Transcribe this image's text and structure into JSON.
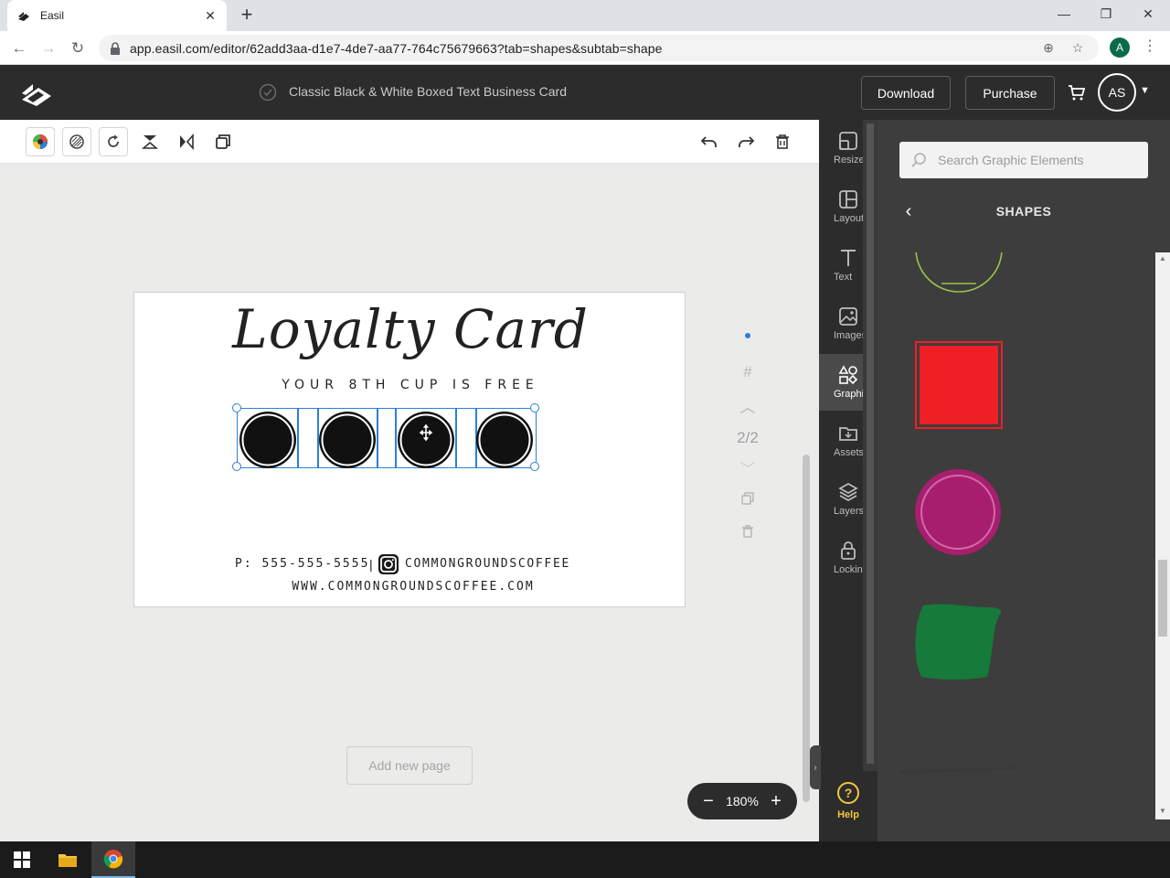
{
  "browser": {
    "tab_title": "Easil",
    "url": "app.easil.com/editor/62add3aa-d1e7-4de7-aa77-764c75679663?tab=shapes&subtab=shape",
    "profile_initial": "A"
  },
  "header": {
    "doc_title": "Classic Black & White Boxed Text Business Card",
    "download_label": "Download",
    "purchase_label": "Purchase",
    "avatar_initials": "AS"
  },
  "toolbar": {
    "left_tools": [
      "color-icon",
      "transparency-icon",
      "rotate-icon",
      "flip-vertical-icon",
      "flip-horizontal-icon",
      "duplicate-icon"
    ],
    "right_tools": [
      "undo-icon",
      "redo-icon",
      "delete-icon"
    ]
  },
  "card": {
    "title": "Loyalty Card",
    "subtitle": "YOUR 8TH CUP IS FREE",
    "phone": "P: 555-555-5555",
    "separator": "|",
    "instagram_handle": "COMMONGROUNDSCOFFEE",
    "website": "WWW.COMMONGROUNDSCOFFEE.COM",
    "stamp_count": 4
  },
  "page_nav": {
    "page_count": "2/2"
  },
  "canvas": {
    "add_page_label": "Add new page",
    "zoom": "180%"
  },
  "side_tabs": [
    {
      "label": "Resize",
      "icon": "resize-icon"
    },
    {
      "label": "Layouts",
      "icon": "layouts-icon"
    },
    {
      "label": "Text",
      "icon": "text-icon"
    },
    {
      "label": "Images",
      "icon": "images-icon"
    },
    {
      "label": "Graphics",
      "icon": "graphics-icon",
      "active": true
    },
    {
      "label": "Assets",
      "icon": "assets-icon"
    },
    {
      "label": "Layers",
      "icon": "layers-icon"
    },
    {
      "label": "Locking",
      "icon": "locking-icon"
    }
  ],
  "help_label": "Help",
  "panel": {
    "search_placeholder": "Search Graphic Elements",
    "title": "SHAPES",
    "shapes": [
      {
        "name": "green-outline-semicircle",
        "color": "#9bc34a"
      },
      {
        "name": "red-square",
        "color": "#ee1f26"
      },
      {
        "name": "magenta-ring-circle",
        "color": "#a81e6e"
      },
      {
        "name": "green-blob",
        "color": "#167a3a"
      },
      {
        "name": "dark-line",
        "color": "#3a3a3a"
      }
    ]
  },
  "colors": {
    "app_dark": "#2c2c2c",
    "selection_blue": "#2d7fd6"
  }
}
